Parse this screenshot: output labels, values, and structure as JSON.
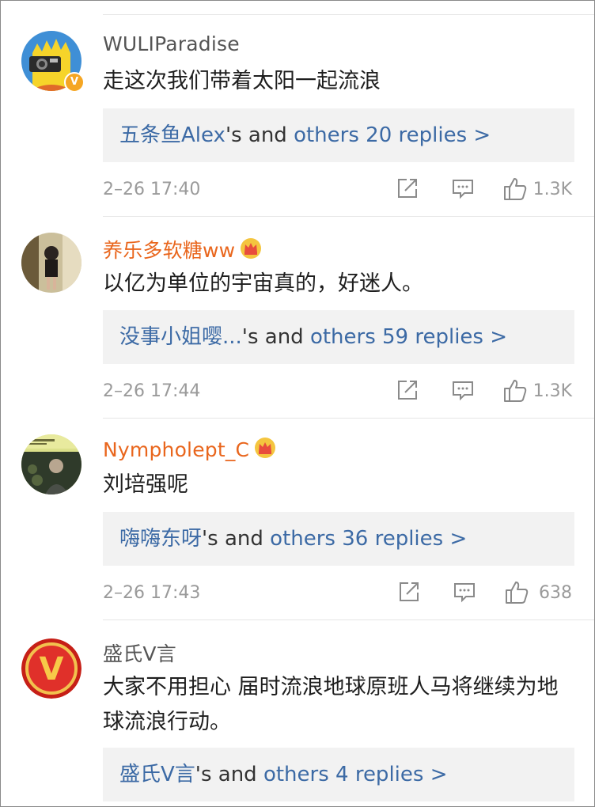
{
  "comments": [
    {
      "username": "WULIParadise",
      "text": "走这次我们带着太阳一起流浪",
      "verified_badge": "V",
      "replies": {
        "lead": "五条鱼Alex",
        "mid": "'s and ",
        "others": "others 20 replies >"
      },
      "time": "2–26 17:40",
      "likes": "1.3K",
      "avatar_icon": "cartoon-avatar"
    },
    {
      "username": "养乐多软糖ww",
      "text": "以亿为单位的宇宙真的，好迷人。",
      "replies": {
        "lead": "没事小姐嘤...",
        "mid": "'s and ",
        "others": "others 59 replies >"
      },
      "time": "2–26 17:44",
      "likes": "1.3K",
      "avatar_icon": "photo-avatar"
    },
    {
      "username": "Nympholept_C",
      "text": "刘培强呢",
      "replies": {
        "lead": "嗨嗨东呀",
        "mid": "'s and ",
        "others": "others 36 replies >"
      },
      "time": "2–26 17:43",
      "likes": "638",
      "avatar_icon": "album-avatar"
    },
    {
      "username": "盛氏V言",
      "text": "大家不用担心 届时流浪地球原班人马将继续为地球流浪行动。",
      "avatar_letter": "V",
      "replies": {
        "lead": "盛氏V言",
        "mid": "'s and ",
        "others": "others 4 replies >"
      },
      "avatar_icon": "v-logo-avatar"
    }
  ],
  "colors": {
    "link": "#3c6aa5",
    "member_name": "#e9661d",
    "meta": "#9a9a9a",
    "reply_bg": "#f2f2f2"
  }
}
